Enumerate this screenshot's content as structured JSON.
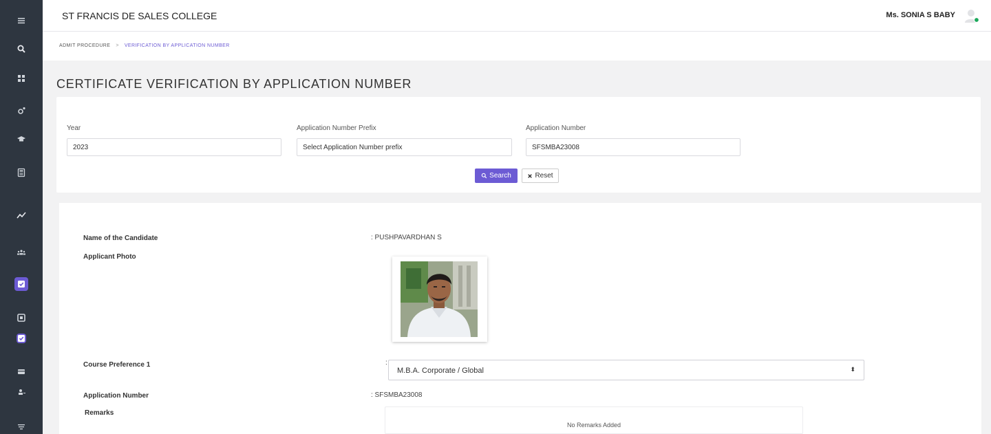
{
  "header": {
    "college_name": "ST FRANCIS DE SALES COLLEGE",
    "user_name": "Ms. SONIA S BABY"
  },
  "breadcrumb": {
    "root": "ADMIT PROCEDURE",
    "separator": ">",
    "current": "VERIFICATION BY APPLICATION NUMBER"
  },
  "page": {
    "title": "CERTIFICATE VERIFICATION BY APPLICATION NUMBER"
  },
  "filters": {
    "year": {
      "label": "Year",
      "value": "2023"
    },
    "prefix": {
      "label": "Application Number Prefix",
      "value": "Select Application Number prefix"
    },
    "app_number": {
      "label": "Application Number",
      "value": "SFSMBA23008"
    },
    "search_label": "Search",
    "reset_label": "Reset"
  },
  "details": {
    "name_label": "Name of the Candidate",
    "name_value": ": PUSHPAVARDHAN S",
    "photo_label": "Applicant Photo",
    "course_label": "Course Preference 1",
    "course_colon": ":",
    "course_value": "M.B.A. Corporate / Global",
    "appno_label": "Application Number",
    "appno_value": ": SFSMBA23008",
    "remarks_label": "Remarks",
    "remarks_value": "No Remarks Added"
  },
  "sidebar": {
    "icons": [
      "menu-icon",
      "search-icon",
      "dashboard-icon",
      "settings-icon",
      "graduation-cap-icon",
      "calculator-icon",
      "chart-line-icon",
      "users-icon",
      "check-square-icon",
      "square-icon",
      "check-square-icon",
      "card-icon",
      "user-plus-icon",
      "filter-icon"
    ]
  },
  "colors": {
    "accent": "#6c5bd4",
    "sidebar_bg": "#2e3640",
    "online_status": "#1aa85a"
  }
}
